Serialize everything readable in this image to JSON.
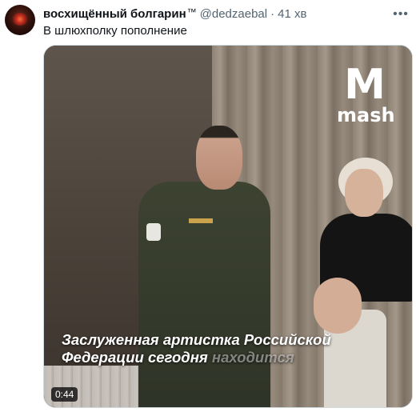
{
  "tweet": {
    "author": {
      "display_name": "восхищённый болгарин",
      "verified_badge": "™",
      "handle": "@dedzaebal",
      "separator": "·",
      "time": "41 хв"
    },
    "more_icon": "more-horizontal-icon",
    "text": "В шлюхполку пополнение",
    "media": {
      "type": "video",
      "watermark": {
        "logo": "М",
        "brand": "mash"
      },
      "caption": {
        "line1": "Заслуженная артистка Российской",
        "line2_main": "Федерации сегодня",
        "line2_faded": "находится"
      },
      "duration": "0:44"
    }
  }
}
